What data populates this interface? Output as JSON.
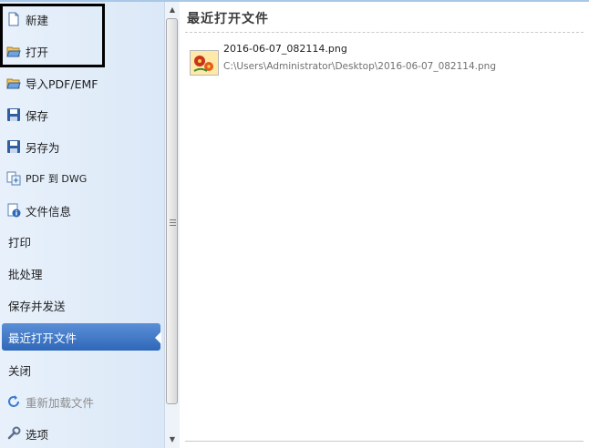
{
  "sidebar": {
    "items": [
      {
        "label": "新建",
        "icon": "new-document-icon"
      },
      {
        "label": "打开",
        "icon": "open-folder-icon"
      },
      {
        "label": "导入PDF/EMF",
        "icon": "import-folder-icon"
      },
      {
        "label": "保存",
        "icon": "save-disk-icon"
      },
      {
        "label": "另存为",
        "icon": "save-as-disk-icon"
      },
      {
        "label": "PDF 到 DWG",
        "icon": "pdf-to-dwg-icon"
      },
      {
        "label": "文件信息",
        "icon": "file-info-icon"
      },
      {
        "label": "打印"
      },
      {
        "label": "批处理"
      },
      {
        "label": "保存并发送"
      },
      {
        "label": "最近打开文件",
        "selected": true
      },
      {
        "label": "关闭"
      },
      {
        "label": "重新加载文件",
        "icon": "reload-icon",
        "disabled": true
      },
      {
        "label": "选项",
        "icon": "wrench-icon"
      }
    ]
  },
  "main": {
    "title": "最近打开文件",
    "recent_files": [
      {
        "name": "2016-06-07_082114.png",
        "path": "C:\\Users\\Administrator\\Desktop\\2016-06-07_082114.png",
        "icon": "image-file-icon"
      }
    ]
  },
  "colors": {
    "accent": "#2f68b9",
    "sidebar_bg": "#dbe8f7",
    "highlight_border": "#000000"
  }
}
